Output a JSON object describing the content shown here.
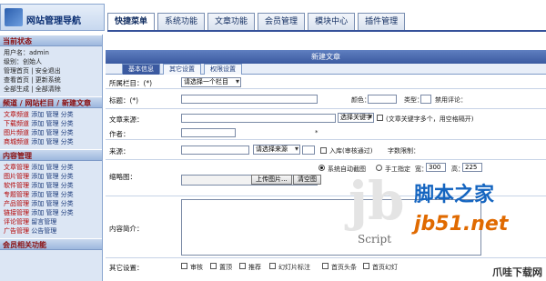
{
  "header": {
    "logo_text": "网站管理导航",
    "tabs": [
      "快捷菜单",
      "系统功能",
      "文章功能",
      "会员管理",
      "模块中心",
      "插件管理"
    ]
  },
  "sidebar": {
    "status": {
      "title": "当前状态",
      "lines": [
        "用户名：admin",
        "级别：创始人",
        "管理首页 | 安全退出",
        "查看首页 | 更新系统",
        "全部生成 | 全部清除"
      ]
    },
    "channels": {
      "title": "频道 / 网站栏目 / 新建文章",
      "items": [
        {
          "cat": "文章频道",
          "ops": "添加 管理 分类"
        },
        {
          "cat": "下载频道",
          "ops": "添加 管理 分类"
        },
        {
          "cat": "图片频道",
          "ops": "添加 管理 分类"
        },
        {
          "cat": "商城频道",
          "ops": "添加 管理 分类"
        }
      ]
    },
    "content": {
      "title": "内容管理",
      "items": [
        {
          "cat": "文章管理",
          "ops": "添加 管理 分类"
        },
        {
          "cat": "图片管理",
          "ops": "添加 管理 分类"
        },
        {
          "cat": "软件管理",
          "ops": "添加 管理 分类"
        },
        {
          "cat": "专题管理",
          "ops": "添加 管理 分类"
        },
        {
          "cat": "产品管理",
          "ops": "添加 管理 分类"
        },
        {
          "cat": "链接管理",
          "ops": "添加 管理 分类"
        },
        {
          "cat": "评论管理",
          "ops": "留言管理"
        },
        {
          "cat": "广告管理",
          "ops": "公告管理"
        }
      ]
    },
    "member": {
      "title": "会员相关功能"
    }
  },
  "form": {
    "title": "新建文章",
    "subtabs": [
      "基本信息",
      "其它设置",
      "权限设置"
    ],
    "category_label": "所属栏目：(*)",
    "category_value": "请选择一个栏目",
    "title_label": "标题：(*)",
    "color_label": "颜色：",
    "type_label": "类型：",
    "comment_label": "禁用评论：",
    "source_label": "文章来源：",
    "keyword_btn": "选择关键字",
    "keyword_hint": "(文章关键字多个，用空格隔开)",
    "author_label": "作者：",
    "author_hint": "*",
    "city_label": "来源：",
    "city_value": "请选择来源",
    "audit_label": "入库(审核通过)",
    "audit_hint": "字数限制：",
    "thumb_label": "缩略图：",
    "auto_thumb": "系统自动截图",
    "manual_thumb": "手工指定",
    "width_label": "宽：",
    "width_value": "300",
    "height_label": "高：",
    "height_value": "225",
    "upload_btn": "上传图片...",
    "clear_btn": "清空图",
    "content_label": "内容简介：",
    "misc_label": "其它设置：",
    "misc_options": [
      "审核",
      "置顶",
      "推荐",
      "幻灯片标注",
      "首页头条",
      "首页幻灯"
    ]
  },
  "watermark": {
    "logo_mark": "jb",
    "script_text": "Script",
    "site_cn": "脚本之家",
    "site_url": "jb51.net",
    "corner": "爪哇下载网"
  }
}
